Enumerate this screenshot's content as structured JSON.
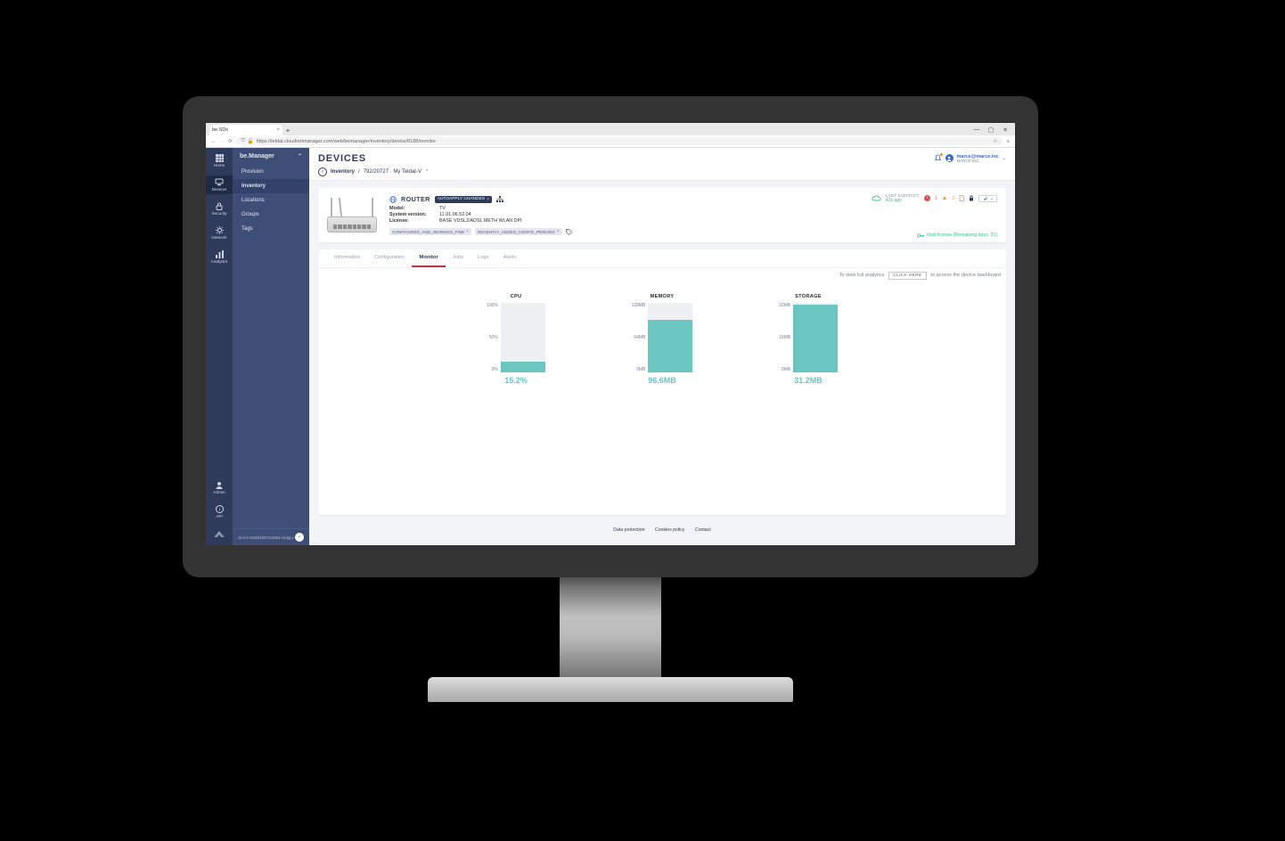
{
  "browser": {
    "tab_title": "be.SDx",
    "url": "https://teldat.cloudnetmanager.com/web/bemanager/inventory/device/8188/monitor"
  },
  "rail": {
    "items": [
      {
        "label": "Home",
        "icon": "grid"
      },
      {
        "label": "Devices",
        "icon": "device",
        "active": true
      },
      {
        "label": "Security",
        "icon": "lock"
      },
      {
        "label": "Network",
        "icon": "gear"
      },
      {
        "label": "Analytics",
        "icon": "chart"
      }
    ],
    "bottom": [
      {
        "label": "Admin",
        "icon": "user"
      },
      {
        "label": "API",
        "icon": "info"
      }
    ]
  },
  "sidebar": {
    "title": "be.Manager",
    "items": [
      {
        "label": "Provision"
      },
      {
        "label": "Inventory",
        "active": true
      },
      {
        "label": "Locations"
      },
      {
        "label": "Groups"
      },
      {
        "label": "Tags"
      }
    ],
    "version": "v5.0.0-e20231007114854-cergq.x"
  },
  "header": {
    "title": "DEVICES",
    "user_email": "marce@marce.inc",
    "user_org": "MARCE INC."
  },
  "breadcrumb": {
    "root": "Inventory",
    "path": "792/20727 · My Teldat-V"
  },
  "device": {
    "type": "ROUTER",
    "autoapply_badge": "AUTOAPPLY CHANGES",
    "specs": {
      "model_k": "Model:",
      "model_v": "TV",
      "sysver_k": "System version:",
      "sysver_v": "11.01.06.52.04",
      "license_k": "License:",
      "license_v": "BASE VDSL2/ADSL METH WLAN DPI"
    },
    "chips": [
      "CONFIGURED_AND_WORKING_FINE",
      "RECENTLY_ADDED_CONFIG_PENDING"
    ],
    "last_contact_label": "LAST CONTACT",
    "last_contact_value": "42s ago",
    "alert1": "1",
    "alert2": "2",
    "license_status": "Valid license (Remaining days: 31)"
  },
  "tabs": [
    "Information",
    "Configuration",
    "Monitor",
    "Jobs",
    "Logs",
    "Alerts"
  ],
  "active_tab": "Monitor",
  "analytics_note_pre": "To view full analytics",
  "analytics_btn": "CLICK HERE",
  "analytics_note_post": "to access the device dashboard",
  "chart_data": [
    {
      "type": "bar",
      "title": "CPU",
      "categories": [
        ""
      ],
      "values": [
        15.2
      ],
      "ylim": [
        0,
        100
      ],
      "ticks": [
        "100%",
        "50%",
        "0%"
      ],
      "display": "15.2%",
      "fill_pct": 15.2
    },
    {
      "type": "bar",
      "title": "MEMORY",
      "categories": [
        ""
      ],
      "values": [
        96.6
      ],
      "ylim": [
        0,
        128
      ],
      "ticks": [
        "128MB",
        "64MB",
        "0MB"
      ],
      "display": "96.6MB",
      "fill_pct": 75.5
    },
    {
      "type": "bar",
      "title": "STORAGE",
      "categories": [
        ""
      ],
      "values": [
        31.2
      ],
      "ylim": [
        0,
        32
      ],
      "ticks": [
        "32MB",
        "16MB",
        "0MB"
      ],
      "display": "31.2MB",
      "fill_pct": 97.5
    }
  ],
  "footer": [
    "Data protection",
    "Cookies policy",
    "Contact"
  ]
}
